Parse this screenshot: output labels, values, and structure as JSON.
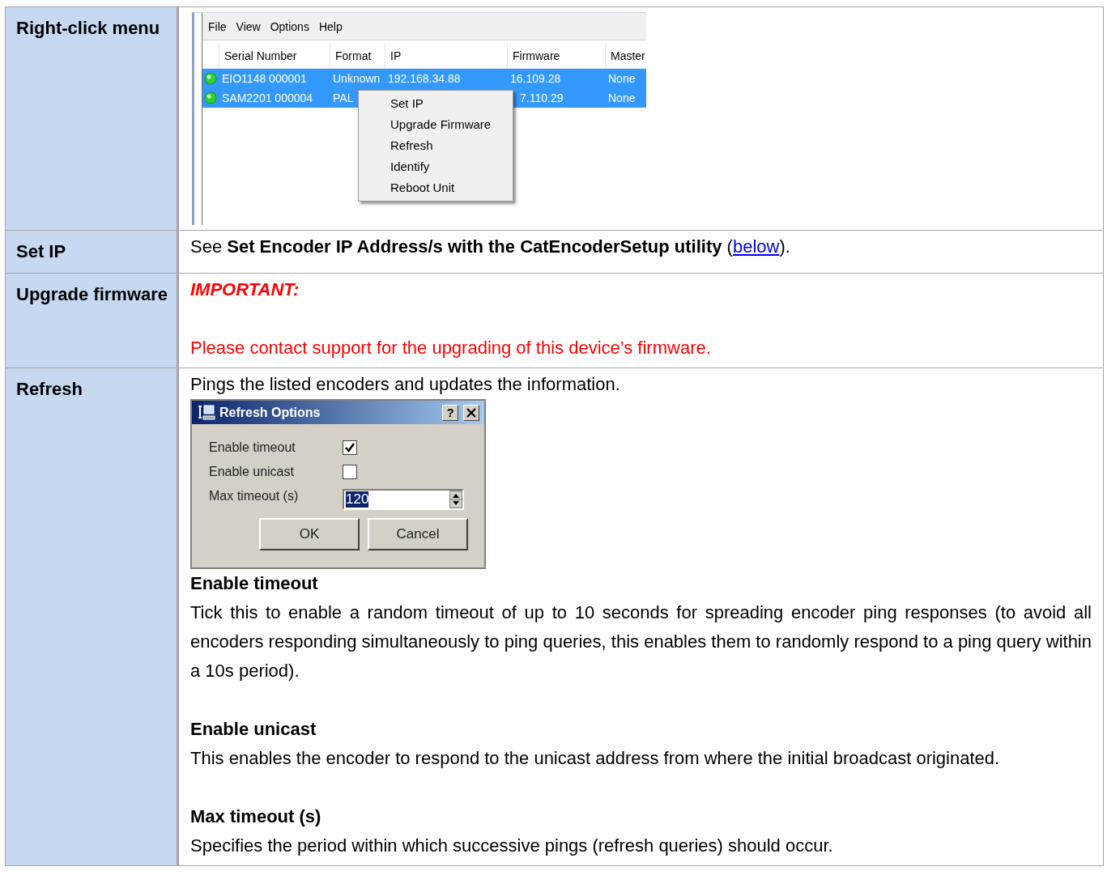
{
  "rows": [
    {
      "label": "Right-click menu",
      "kind": "app_screenshot",
      "app": {
        "menu": [
          "File",
          "View",
          "Options",
          "Help"
        ],
        "columns": [
          "Serial Number",
          "Format",
          "IP",
          "Firmware",
          "Master"
        ],
        "devices": [
          {
            "selected": true,
            "serial": "EIO1148 000001",
            "format": "Unknown",
            "ip": "192.168.34.88",
            "firmware": "16.109.28",
            "master": "None"
          },
          {
            "selected": true,
            "serial": "SAM2201 000004",
            "format": "PAL",
            "firmware": "7.110.29",
            "master": "None"
          }
        ],
        "context_menu": [
          "Set IP",
          "Upgrade Firmware",
          "Refresh",
          "Identify",
          "Reboot Unit"
        ]
      }
    },
    {
      "label": "Set IP",
      "kind": "link_text",
      "before": "See **Set Encoder IP Address/s with the CatEncoderSetup utility** (",
      "link": "below",
      "after": ")."
    },
    {
      "label": "Upgrade firmware",
      "kind": "warning",
      "heading": "IMPORTANT:",
      "text": "Please contact support for the upgrading of this device’s firmware."
    },
    {
      "label": "Refresh",
      "kind": "dialog_help",
      "intro": "Pings the listed encoders and updates the information.",
      "dialog": {
        "title": "Refresh Options",
        "help": "?",
        "fields": [
          {
            "kind": "checkbox",
            "label": "Enable timeout",
            "checked": true
          },
          {
            "kind": "checkbox",
            "label": "Enable unicast",
            "checked": false
          },
          {
            "kind": "spin",
            "label": "Max timeout (s)",
            "value": "120"
          }
        ],
        "buttons": [
          "OK",
          "Cancel"
        ]
      },
      "sections": [
        {
          "heading": "Enable timeout",
          "text": "Tick this to enable a random timeout of up to 10 seconds for spreading encoder ping responses (to avoid all encoders responding simultaneously to ping queries, this enables them to randomly respond to a ping query within a 10s period)."
        },
        {
          "heading": "Enable unicast",
          "text": "This enables the encoder to respond to the unicast address from where the initial broadcast originated."
        },
        {
          "heading": "Max timeout (s)",
          "text": "Specifies the period within which successive pings (refresh queries) should occur."
        }
      ]
    }
  ]
}
